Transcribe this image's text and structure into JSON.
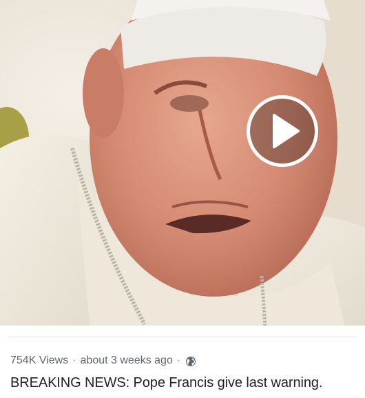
{
  "video": {
    "play_icon": "play-icon"
  },
  "post": {
    "views": "754K Views",
    "separator": "·",
    "timestamp": "about 3 weeks ago",
    "privacy_icon": "globe-icon",
    "title": "BREAKING NEWS: Pope Francis give last warning."
  },
  "colors": {
    "meta_text": "#616770",
    "title_text": "#1d2129",
    "divider": "#dddfe2"
  }
}
